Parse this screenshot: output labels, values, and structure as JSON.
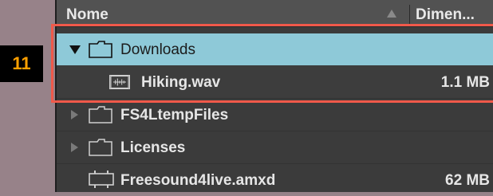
{
  "header": {
    "name_col": "Nome",
    "size_col": "Dimen..."
  },
  "step_badge": "11",
  "rows": [
    {
      "label": "Downloads",
      "icon": "folder-icon",
      "expanded": true,
      "selected": true
    },
    {
      "label": "Hiking.wav",
      "icon": "audio-file-icon",
      "size": "1.1 MB"
    },
    {
      "label": "FS4LtempFiles",
      "icon": "folder-icon",
      "expanded": false
    },
    {
      "label": "Licenses",
      "icon": "folder-icon",
      "expanded": false
    },
    {
      "label": "Freesound4live.amxd",
      "icon": "max-device-icon",
      "size": "62 MB"
    }
  ],
  "colors": {
    "selection": "#8ec9d8",
    "highlight": "#f0594a",
    "badge_text": "#ffa000"
  }
}
